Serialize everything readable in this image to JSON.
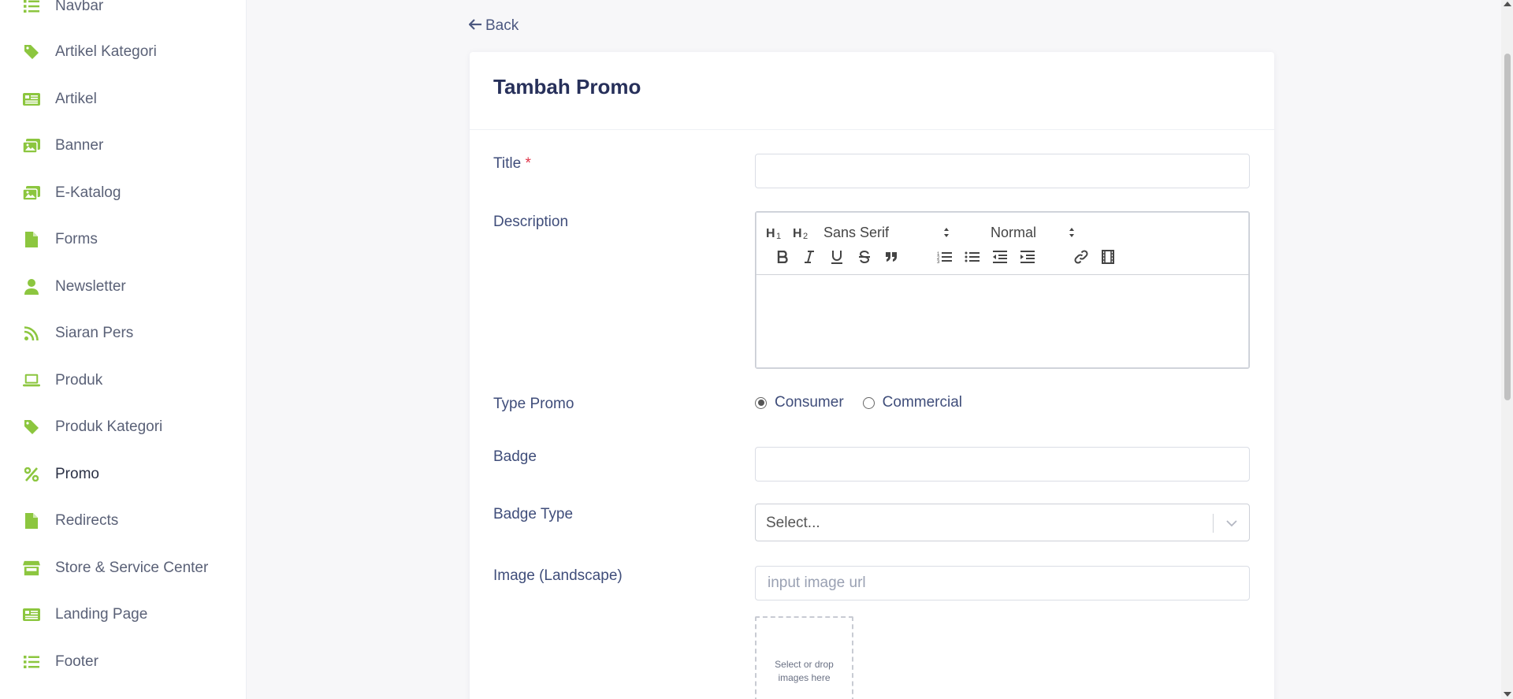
{
  "sidebar": {
    "accent_color": "#8cc63f",
    "items": [
      {
        "label": "Navbar",
        "icon": "list-icon"
      },
      {
        "label": "Artikel Kategori",
        "icon": "tag-icon"
      },
      {
        "label": "Artikel",
        "icon": "newspaper-icon"
      },
      {
        "label": "Banner",
        "icon": "images-icon"
      },
      {
        "label": "E-Katalog",
        "icon": "images-icon"
      },
      {
        "label": "Forms",
        "icon": "file-icon"
      },
      {
        "label": "Newsletter",
        "icon": "user-icon"
      },
      {
        "label": "Siaran Pers",
        "icon": "rss-icon"
      },
      {
        "label": "Produk",
        "icon": "laptop-icon"
      },
      {
        "label": "Produk Kategori",
        "icon": "tag-icon"
      },
      {
        "label": "Promo",
        "icon": "percent-icon",
        "active": true
      },
      {
        "label": "Redirects",
        "icon": "file-icon"
      },
      {
        "label": "Store & Service Center",
        "icon": "store-icon"
      },
      {
        "label": "Landing Page",
        "icon": "newspaper-icon"
      },
      {
        "label": "Footer",
        "icon": "list-icon"
      }
    ]
  },
  "back": {
    "label": "Back"
  },
  "form": {
    "title": "Tambah Promo",
    "fields": {
      "title": {
        "label": "Title",
        "required_mark": "*",
        "value": ""
      },
      "description": {
        "label": "Description"
      },
      "type_promo": {
        "label": "Type Promo",
        "options": [
          "Consumer",
          "Commercial"
        ],
        "selected": "Consumer"
      },
      "badge": {
        "label": "Badge",
        "value": ""
      },
      "badge_type": {
        "label": "Badge Type",
        "placeholder": "Select..."
      },
      "image_landscape": {
        "label": "Image (Landscape)",
        "placeholder": "input image url",
        "dropzone_text": "Select or drop images here"
      }
    },
    "editor": {
      "font": "Sans Serif",
      "size": "Normal"
    }
  }
}
